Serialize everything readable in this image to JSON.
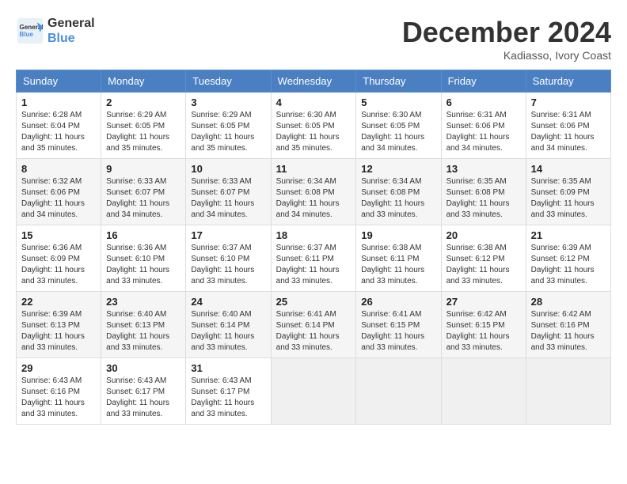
{
  "logo": {
    "line1": "General",
    "line2": "Blue"
  },
  "title": "December 2024",
  "location": "Kadiasso, Ivory Coast",
  "days_of_week": [
    "Sunday",
    "Monday",
    "Tuesday",
    "Wednesday",
    "Thursday",
    "Friday",
    "Saturday"
  ],
  "weeks": [
    [
      {
        "day": "1",
        "info": "Sunrise: 6:28 AM\nSunset: 6:04 PM\nDaylight: 11 hours\nand 35 minutes."
      },
      {
        "day": "2",
        "info": "Sunrise: 6:29 AM\nSunset: 6:05 PM\nDaylight: 11 hours\nand 35 minutes."
      },
      {
        "day": "3",
        "info": "Sunrise: 6:29 AM\nSunset: 6:05 PM\nDaylight: 11 hours\nand 35 minutes."
      },
      {
        "day": "4",
        "info": "Sunrise: 6:30 AM\nSunset: 6:05 PM\nDaylight: 11 hours\nand 35 minutes."
      },
      {
        "day": "5",
        "info": "Sunrise: 6:30 AM\nSunset: 6:05 PM\nDaylight: 11 hours\nand 34 minutes."
      },
      {
        "day": "6",
        "info": "Sunrise: 6:31 AM\nSunset: 6:06 PM\nDaylight: 11 hours\nand 34 minutes."
      },
      {
        "day": "7",
        "info": "Sunrise: 6:31 AM\nSunset: 6:06 PM\nDaylight: 11 hours\nand 34 minutes."
      }
    ],
    [
      {
        "day": "8",
        "info": "Sunrise: 6:32 AM\nSunset: 6:06 PM\nDaylight: 11 hours\nand 34 minutes."
      },
      {
        "day": "9",
        "info": "Sunrise: 6:33 AM\nSunset: 6:07 PM\nDaylight: 11 hours\nand 34 minutes."
      },
      {
        "day": "10",
        "info": "Sunrise: 6:33 AM\nSunset: 6:07 PM\nDaylight: 11 hours\nand 34 minutes."
      },
      {
        "day": "11",
        "info": "Sunrise: 6:34 AM\nSunset: 6:08 PM\nDaylight: 11 hours\nand 34 minutes."
      },
      {
        "day": "12",
        "info": "Sunrise: 6:34 AM\nSunset: 6:08 PM\nDaylight: 11 hours\nand 33 minutes."
      },
      {
        "day": "13",
        "info": "Sunrise: 6:35 AM\nSunset: 6:08 PM\nDaylight: 11 hours\nand 33 minutes."
      },
      {
        "day": "14",
        "info": "Sunrise: 6:35 AM\nSunset: 6:09 PM\nDaylight: 11 hours\nand 33 minutes."
      }
    ],
    [
      {
        "day": "15",
        "info": "Sunrise: 6:36 AM\nSunset: 6:09 PM\nDaylight: 11 hours\nand 33 minutes."
      },
      {
        "day": "16",
        "info": "Sunrise: 6:36 AM\nSunset: 6:10 PM\nDaylight: 11 hours\nand 33 minutes."
      },
      {
        "day": "17",
        "info": "Sunrise: 6:37 AM\nSunset: 6:10 PM\nDaylight: 11 hours\nand 33 minutes."
      },
      {
        "day": "18",
        "info": "Sunrise: 6:37 AM\nSunset: 6:11 PM\nDaylight: 11 hours\nand 33 minutes."
      },
      {
        "day": "19",
        "info": "Sunrise: 6:38 AM\nSunset: 6:11 PM\nDaylight: 11 hours\nand 33 minutes."
      },
      {
        "day": "20",
        "info": "Sunrise: 6:38 AM\nSunset: 6:12 PM\nDaylight: 11 hours\nand 33 minutes."
      },
      {
        "day": "21",
        "info": "Sunrise: 6:39 AM\nSunset: 6:12 PM\nDaylight: 11 hours\nand 33 minutes."
      }
    ],
    [
      {
        "day": "22",
        "info": "Sunrise: 6:39 AM\nSunset: 6:13 PM\nDaylight: 11 hours\nand 33 minutes."
      },
      {
        "day": "23",
        "info": "Sunrise: 6:40 AM\nSunset: 6:13 PM\nDaylight: 11 hours\nand 33 minutes."
      },
      {
        "day": "24",
        "info": "Sunrise: 6:40 AM\nSunset: 6:14 PM\nDaylight: 11 hours\nand 33 minutes."
      },
      {
        "day": "25",
        "info": "Sunrise: 6:41 AM\nSunset: 6:14 PM\nDaylight: 11 hours\nand 33 minutes."
      },
      {
        "day": "26",
        "info": "Sunrise: 6:41 AM\nSunset: 6:15 PM\nDaylight: 11 hours\nand 33 minutes."
      },
      {
        "day": "27",
        "info": "Sunrise: 6:42 AM\nSunset: 6:15 PM\nDaylight: 11 hours\nand 33 minutes."
      },
      {
        "day": "28",
        "info": "Sunrise: 6:42 AM\nSunset: 6:16 PM\nDaylight: 11 hours\nand 33 minutes."
      }
    ],
    [
      {
        "day": "29",
        "info": "Sunrise: 6:43 AM\nSunset: 6:16 PM\nDaylight: 11 hours\nand 33 minutes."
      },
      {
        "day": "30",
        "info": "Sunrise: 6:43 AM\nSunset: 6:17 PM\nDaylight: 11 hours\nand 33 minutes."
      },
      {
        "day": "31",
        "info": "Sunrise: 6:43 AM\nSunset: 6:17 PM\nDaylight: 11 hours\nand 33 minutes."
      },
      {
        "day": "",
        "info": ""
      },
      {
        "day": "",
        "info": ""
      },
      {
        "day": "",
        "info": ""
      },
      {
        "day": "",
        "info": ""
      }
    ]
  ]
}
